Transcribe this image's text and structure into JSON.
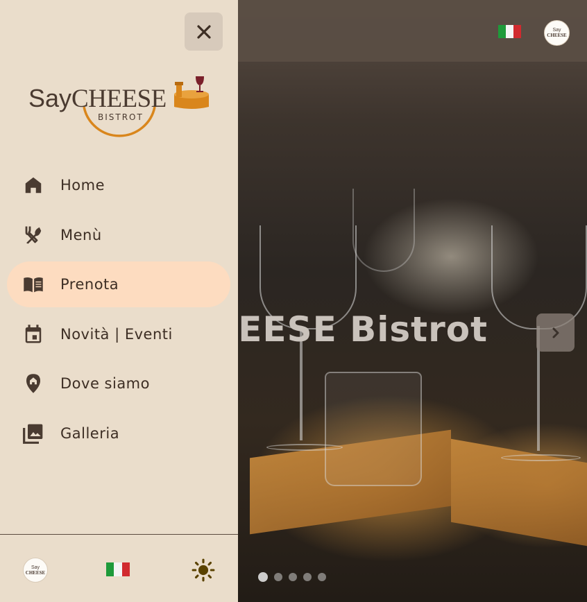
{
  "hero": {
    "title": "EESE Bistrot",
    "slides_count": 5,
    "active_slide": 1,
    "next_icon": "chevron-right-icon"
  },
  "header": {
    "language_flag": "italy-flag-icon",
    "logo_text_top": "Say",
    "logo_text_bottom": "CHEESE"
  },
  "drawer": {
    "close_icon": "close-icon",
    "logo": {
      "say": "Say",
      "cheese": "CHEESE",
      "bistrot": "BISTROT"
    },
    "nav": [
      {
        "label": "Home",
        "icon": "home-icon",
        "active": false
      },
      {
        "label": "Menù",
        "icon": "utensils-icon",
        "active": false
      },
      {
        "label": "Prenota",
        "icon": "book-icon",
        "active": true
      },
      {
        "label": "Novità | Eventi",
        "icon": "calendar-event-icon",
        "active": false
      },
      {
        "label": "Dove siamo",
        "icon": "location-pin-icon",
        "active": false
      },
      {
        "label": "Galleria",
        "icon": "photo-library-icon",
        "active": false
      }
    ],
    "footer": {
      "logo_top": "Say",
      "logo_bottom": "CHEESE",
      "flag": "italy-flag-icon",
      "theme_icon": "sun-icon"
    }
  },
  "colors": {
    "drawer_bg": "#eaddcb",
    "active_item_bg": "#fddcc0",
    "text": "#3d2e24",
    "logo_orange": "#d9861c",
    "wine": "#7a1f2a"
  }
}
